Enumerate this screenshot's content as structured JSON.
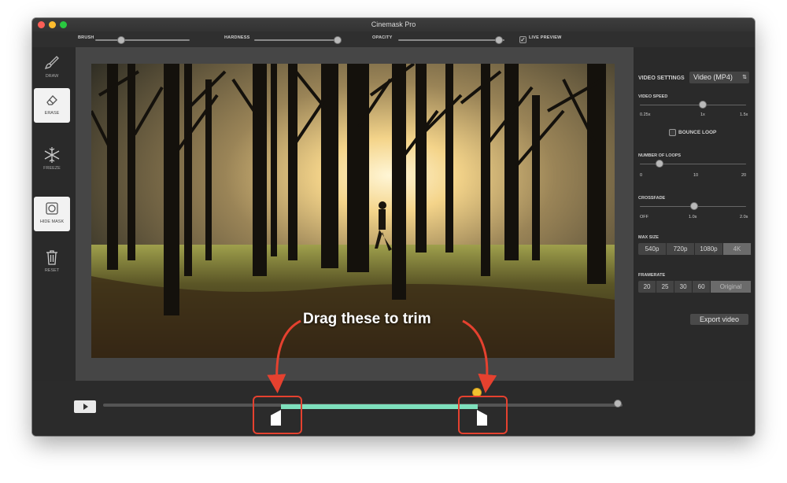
{
  "window": {
    "title": "Cinemask Pro"
  },
  "toolbar": {
    "brush_label": "BRUSH",
    "hardness_label": "HARDNESS",
    "opacity_label": "OPACITY",
    "live_preview_label": "LIVE PREVIEW",
    "live_preview_checked": true
  },
  "tools": [
    {
      "label": "DRAW",
      "icon": "brush-icon",
      "active": false
    },
    {
      "label": "ERASE",
      "icon": "eraser-icon",
      "active": true
    },
    {
      "label": "FREEZE",
      "icon": "snowflake-icon",
      "active": false
    },
    {
      "label": "HIDE MASK",
      "icon": "mask-icon",
      "active": true
    },
    {
      "label": "RESET",
      "icon": "trash-icon",
      "active": false
    }
  ],
  "settings": {
    "title": "VIDEO SETTINGS",
    "format": "Video (MP4)",
    "video_speed": {
      "label": "VIDEO SPEED",
      "ticks": [
        "0.25x",
        "1x",
        "1.5x"
      ]
    },
    "bounce_loop": "BOUNCE LOOP",
    "loops": {
      "label": "NUMBER OF LOOPS",
      "ticks": [
        "0",
        "10",
        "20"
      ]
    },
    "crossfade": {
      "label": "CROSSFADE",
      "ticks": [
        "OFF",
        "1.0s",
        "2.0s"
      ]
    },
    "max_size": {
      "label": "MAX SIZE",
      "options": [
        "540p",
        "720p",
        "1080p",
        "4K"
      ],
      "selected": "4K"
    },
    "framerate": {
      "label": "FRAMERATE",
      "options": [
        "20",
        "25",
        "30",
        "60",
        "Original"
      ],
      "selected": "Original"
    },
    "export_label": "Export video"
  },
  "annotation": {
    "text": "Drag these to trim"
  },
  "colors": {
    "trim_range": "#7ee0bd",
    "highlight": "#e5412f"
  }
}
